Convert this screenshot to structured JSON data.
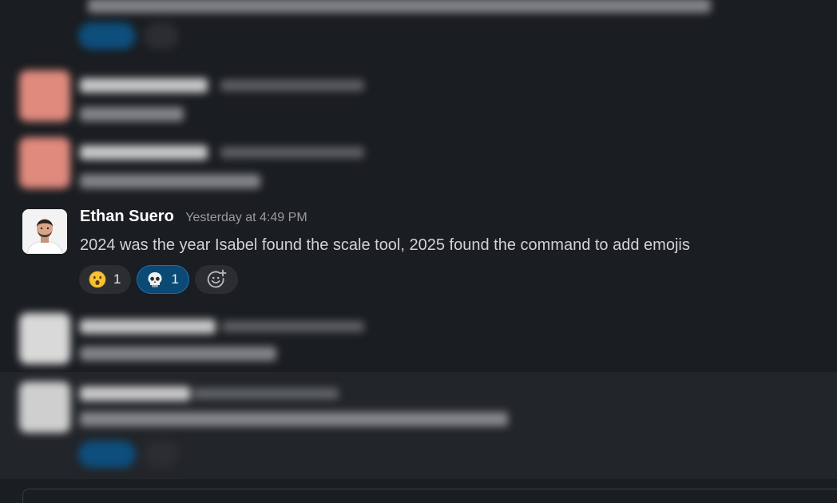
{
  "message": {
    "sender": "Ethan Suero",
    "timestamp": "Yesterday at 4:49 PM",
    "text": "2024 was the year Isabel found the scale tool, 2025 found the command to add emojis",
    "reactions": [
      {
        "emoji": "face-with-open-mouth-icon",
        "count": "1",
        "selected": false
      },
      {
        "emoji": "skull-icon",
        "count": "1",
        "selected": true
      }
    ]
  },
  "colors": {
    "background": "#1a1d21",
    "hover_row": "#222529",
    "reaction_bg": "#2b2d31",
    "reaction_selected_bg": "#0b4a75",
    "sender": "#ffffff",
    "timestamp": "#9a9b9d",
    "text": "#d1d2d3"
  }
}
